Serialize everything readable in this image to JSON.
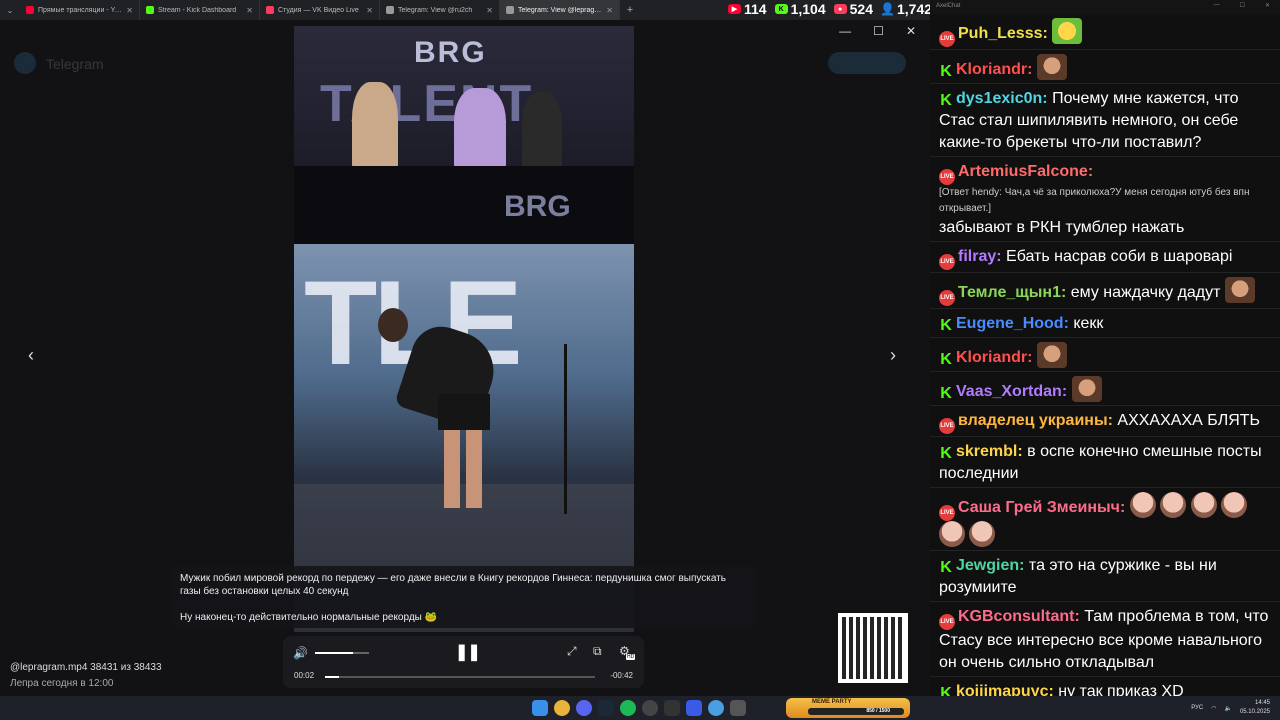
{
  "browser": {
    "tabs": [
      {
        "title": "Прямые трансляции - YouTube",
        "color": "#ff0033",
        "active": false
      },
      {
        "title": "Stream - Kick Dashboard",
        "color": "#53fc18",
        "active": false
      },
      {
        "title": "Студия — VK Видео Live",
        "color": "#ff3b5c",
        "active": false
      },
      {
        "title": "Telegram: View @ru2ch",
        "color": "#999999",
        "active": false
      },
      {
        "title": "Telegram: View @lepragram",
        "color": "#999999",
        "active": true
      }
    ]
  },
  "stats": {
    "youtube": "114",
    "kick": "1,104",
    "vk": "524",
    "total": "1,742"
  },
  "telegram": {
    "title": "Telegram"
  },
  "post": {
    "caption_line1": "Мужик побил мировой рекорд по пердежу — его даже внесли в Книгу рекордов Гиннеса: пердунишка смог выпускать газы без остановки целых 40 секунд",
    "caption_line2": "Ну наконец-то действительно нормальные рекорды 🐸",
    "file_name": "@lepragram.mp4 38431 из 38433",
    "author_time": "Лепра   сегодня в 12:00"
  },
  "player": {
    "current_time": "00:02",
    "remaining_time": "-00:42",
    "volume_level": 0.7,
    "progress": 0.05,
    "hd_badge": "HD"
  },
  "video_overlay": {
    "brg": "BRG",
    "talent": "TALENT",
    "stage_text": "TLE"
  },
  "chat": {
    "window_title": "AxelChat",
    "messages": [
      {
        "platform": "vk",
        "nick": "Puh_Lesss:",
        "color": "#f0e04a",
        "text": "",
        "emotes": [
          "frog"
        ]
      },
      {
        "platform": "kick",
        "nick": "Kloriandr:",
        "color": "#ff4f4f",
        "text": "",
        "emotes": [
          "face"
        ]
      },
      {
        "platform": "kick",
        "nick": "dys1exic0n:",
        "color": "#4fd6e0",
        "text": "Почему мне кажется, что Стас стал шипилявить немного, он себе какие-то брекеты что-ли поставил?",
        "emotes": []
      },
      {
        "platform": "vk",
        "nick": "ArtemiusFalcone:",
        "color": "#ff6b6b",
        "reply": "[Ответ hendy: Чач,а чё за приколюха?У меня сегодня ютуб без впн открывает.]",
        "text": "забывают в РКН тумблер нажать",
        "emotes": []
      },
      {
        "platform": "vk",
        "nick": "filray:",
        "color": "#b27bff",
        "text": "Ебать насрав соби в шароварі",
        "emotes": []
      },
      {
        "platform": "vk",
        "nick": "Темле_щын1:",
        "color": "#8bd65a",
        "text": "ему наждачку дадут",
        "emotes": [
          "face"
        ]
      },
      {
        "platform": "kick",
        "nick": "Eugene_Hood:",
        "color": "#4a8cff",
        "text": "кекк",
        "emotes": []
      },
      {
        "platform": "kick",
        "nick": "Kloriandr:",
        "color": "#ff4f4f",
        "text": "",
        "emotes": [
          "face"
        ]
      },
      {
        "platform": "kick",
        "nick": "Vaas_Xortdan:",
        "color": "#b27bff",
        "text": "",
        "emotes": [
          "face"
        ]
      },
      {
        "platform": "vk",
        "nick": "владелец украины:",
        "color": "#ffb640",
        "text": "АХХАХАХА БЛЯТЬ",
        "emotes": []
      },
      {
        "platform": "kick",
        "nick": "skrembl:",
        "color": "#ffd54a",
        "text": "в оспе конечно смешные посты последнии",
        "emotes": []
      },
      {
        "platform": "vk",
        "nick": "Саша Грей Змеиныч:",
        "color": "#ff6b8b",
        "text": "",
        "emotes": [
          "bald",
          "bald",
          "bald",
          "bald",
          "bald",
          "bald"
        ]
      },
      {
        "platform": "kick",
        "nick": "Jewgien:",
        "color": "#4fd6a0",
        "text": "та это на суржике - вы ни розумиите",
        "emotes": []
      },
      {
        "platform": "vk",
        "nick": "KGBconsultant:",
        "color": "#ff6b8b",
        "text": "Там проблема в том, что Стасу все интересно все кроме навального он очень сильно откладывал",
        "emotes": []
      },
      {
        "platform": "kick",
        "nick": "koiiimapuyc:",
        "color": "#ffd54a",
        "text": "ну так приказ XD",
        "emotes": []
      }
    ]
  },
  "taskbar": {
    "meme_party": "MEME PARTY",
    "meme_progress": "850 / 1500",
    "lang": "РУС",
    "time": "14:45",
    "date": "05.10.2025"
  }
}
